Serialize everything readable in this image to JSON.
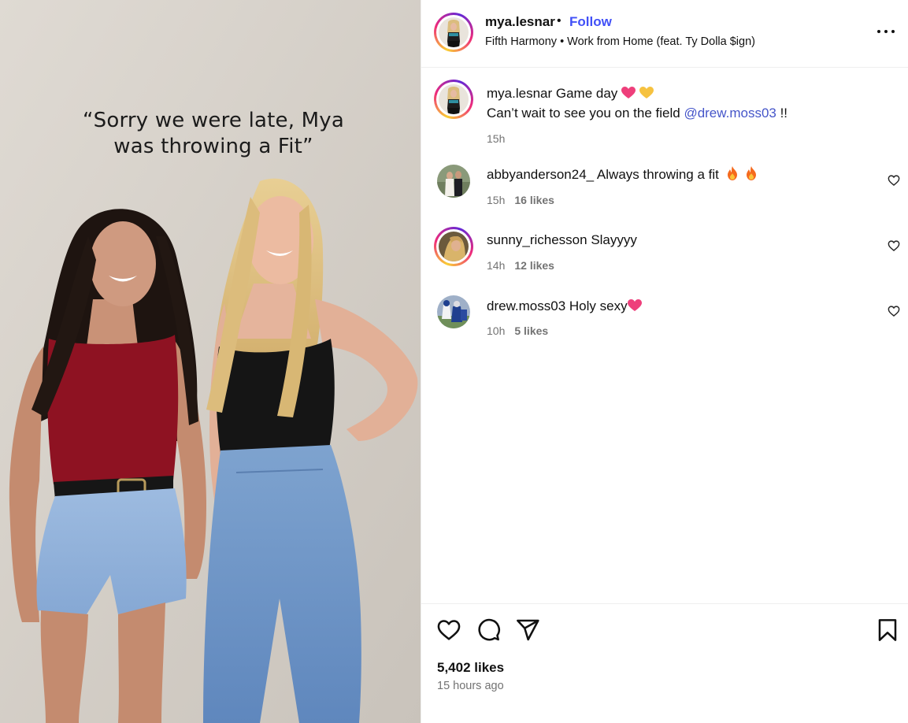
{
  "post": {
    "caption_overlay": [
      "“Sorry we were late, Mya",
      "was throwing a Fit”"
    ],
    "author": "mya.lesnar",
    "follow_label": "Follow",
    "separator": "•",
    "audio": "Fifth Harmony • Work from Home (feat. Ty Dolla $ign)",
    "caption": {
      "username": "mya.lesnar",
      "line1": "Game day",
      "line2_prefix": "Can’t wait to see you on the field ",
      "mention": "@drew.moss03",
      "line2_suffix": " !!",
      "time": "15h"
    },
    "likes": "5,402 likes",
    "posted_ago": "15 hours ago"
  },
  "comments": [
    {
      "username": "abbyanderson24_",
      "text": "Always throwing a fit",
      "time": "15h",
      "likes": "16 likes",
      "emojis": [
        "fire-icon",
        "fire-icon"
      ]
    },
    {
      "username": "sunny_richesson",
      "text": "Slayyyy",
      "time": "14h",
      "likes": "12 likes"
    },
    {
      "username": "drew.moss03",
      "text": "Holy sexy",
      "time": "10h",
      "likes": "5 likes",
      "emojis": [
        "pink-heart-icon"
      ]
    }
  ],
  "icons": {
    "more": "more-options-icon",
    "like": "heart-icon",
    "comment": "comment-icon",
    "share": "send-icon",
    "save": "bookmark-icon"
  },
  "colors": {
    "link_blue": "#4150f7",
    "mention_blue": "#4555c9",
    "muted_text": "#737373",
    "border": "#efefef"
  }
}
